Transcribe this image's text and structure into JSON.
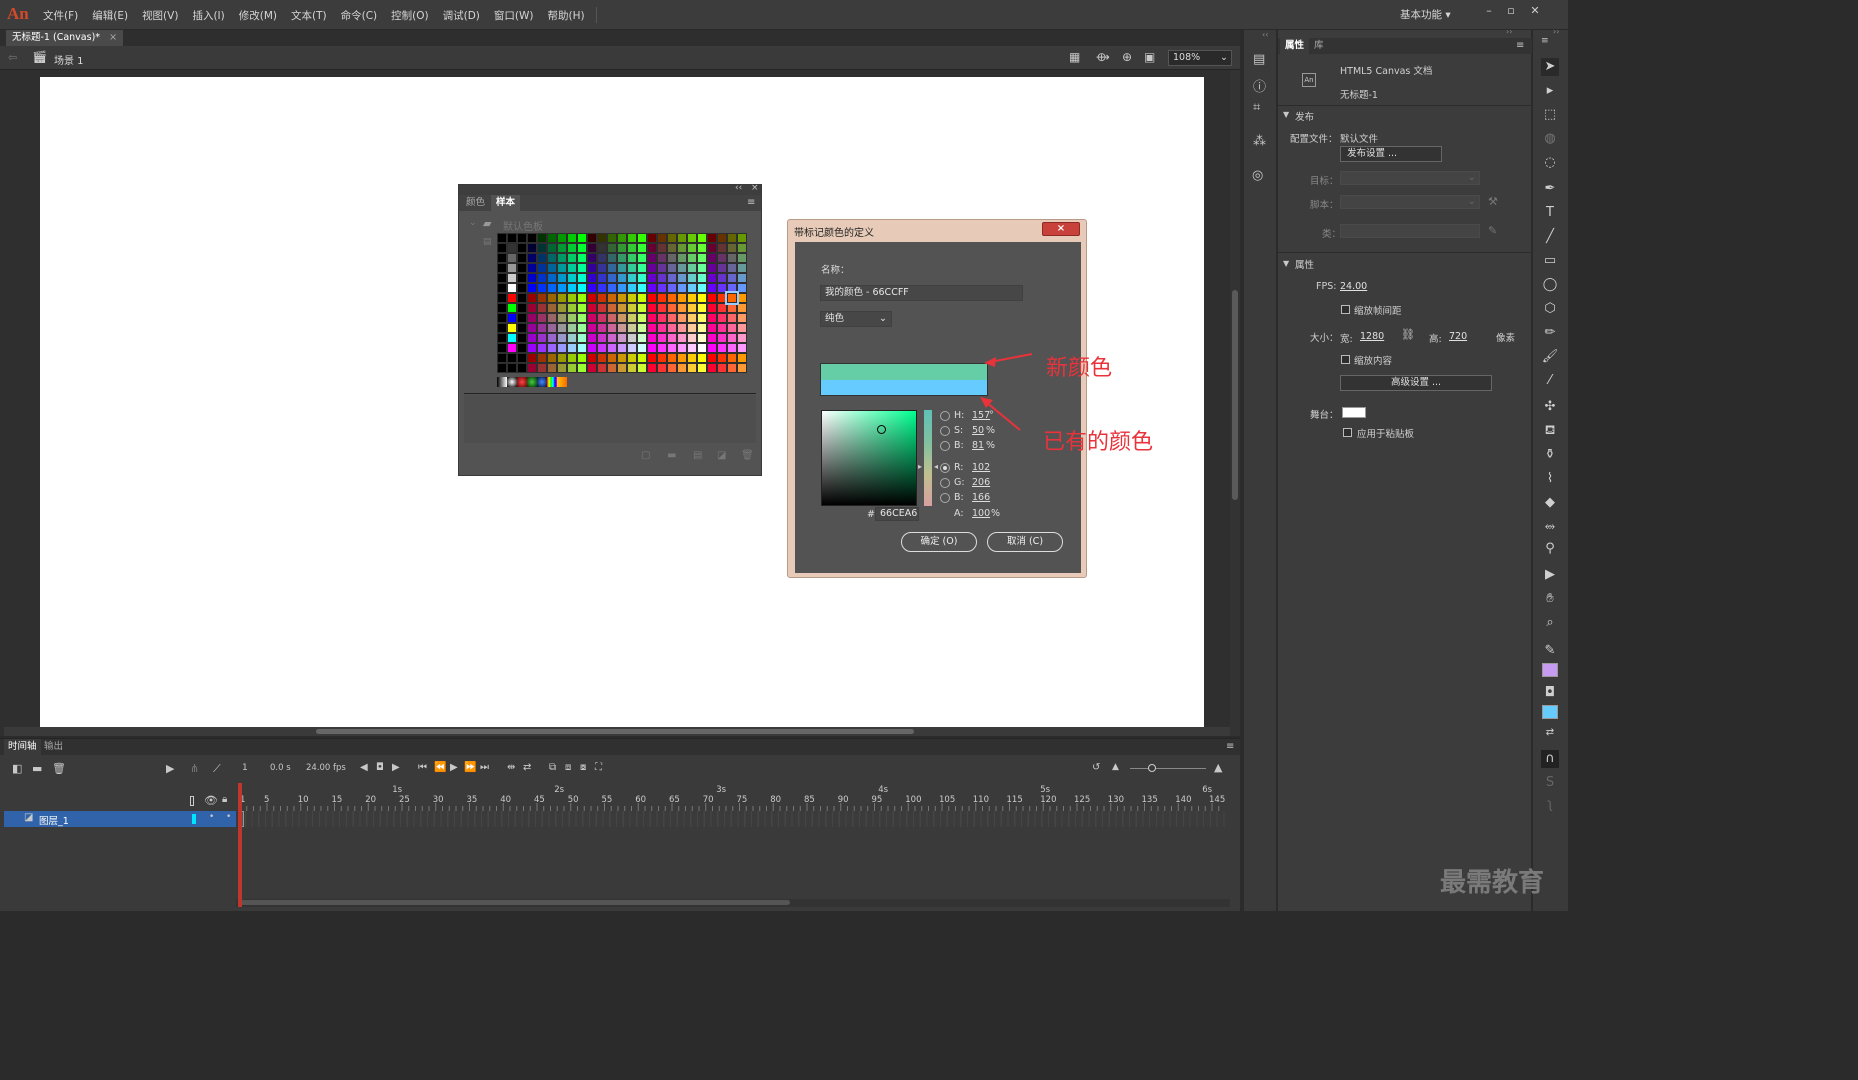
{
  "app": {
    "logo": "An"
  },
  "menu": [
    "文件(F)",
    "编辑(E)",
    "视图(V)",
    "插入(I)",
    "修改(M)",
    "文本(T)",
    "命令(C)",
    "控制(O)",
    "调试(D)",
    "窗口(W)",
    "帮助(H)"
  ],
  "workspace": "基本功能",
  "document": {
    "tab": "无标题-1 (Canvas)*",
    "close": "×",
    "scene": "场景 1",
    "zoom": "108%"
  },
  "swatches": {
    "tab_color": "颜色",
    "tab_swatches": "样本",
    "folder": "默认色板",
    "selected_color": "#66CEA6"
  },
  "dialog": {
    "title": "带标记颜色的定义",
    "close": "×",
    "name_label": "名称：",
    "name_value": "我的颜色 - 66CCFF",
    "type": "纯色",
    "new_color": "#66cea6",
    "old_color": "#66ccff",
    "H_label": "H:",
    "H": "157",
    "H_unit": "°",
    "S_label": "S:",
    "S": "50",
    "S_unit": "%",
    "B_label": "B:",
    "B": "81",
    "B_unit": "%",
    "R_label": "R:",
    "R": "102",
    "G_label": "G:",
    "G": "206",
    "B2_label": "B:",
    "B2": "166",
    "A_label": "A:",
    "A": "100",
    "A_unit": "%",
    "hex_label": "#",
    "hex": "66CEA6",
    "ok": "确定 (O)",
    "cancel": "取消 (C)"
  },
  "annotations": {
    "new": "新颜色",
    "old": "已有的颜色"
  },
  "properties": {
    "tab_props": "属性",
    "tab_lib": "库",
    "doc_type": "HTML5 Canvas 文档",
    "doc_name": "无标题-1",
    "publish_header": "发布",
    "profile_label": "配置文件：",
    "profile_value": "默认文件",
    "publish_settings": "发布设置 ...",
    "target_label": "目标：",
    "script_label": "脚本：",
    "class_label": "类：",
    "props_header": "属性",
    "fps_label": "FPS:",
    "fps": "24.00",
    "scale_spans": "缩放帧间距",
    "size_label": "大小：",
    "width_label": "宽:",
    "width": "1280",
    "height_label": "高:",
    "height": "720",
    "unit": "像素",
    "scale_content": "缩放内容",
    "advanced": "高级设置 ...",
    "stage_label": "舞台：",
    "stage_color": "#ffffff",
    "apply_paste": "应用于粘贴板"
  },
  "timeline": {
    "tab_timeline": "时间轴",
    "tab_output": "输出",
    "frame": "1",
    "time": "0.0 s",
    "fps": "24.00 fps",
    "layer": "图层_1",
    "seconds": [
      "1s",
      "2s",
      "3s",
      "4s",
      "5s",
      "6s"
    ],
    "frame_numbers": [
      "1",
      "5",
      "10",
      "15",
      "20",
      "25",
      "30",
      "35",
      "40",
      "45",
      "50",
      "55",
      "60",
      "65",
      "70",
      "75",
      "80",
      "85",
      "90",
      "95",
      "100",
      "105",
      "110",
      "115",
      "120",
      "125",
      "130",
      "135",
      "140",
      "145"
    ]
  },
  "watermark": "最需教育"
}
